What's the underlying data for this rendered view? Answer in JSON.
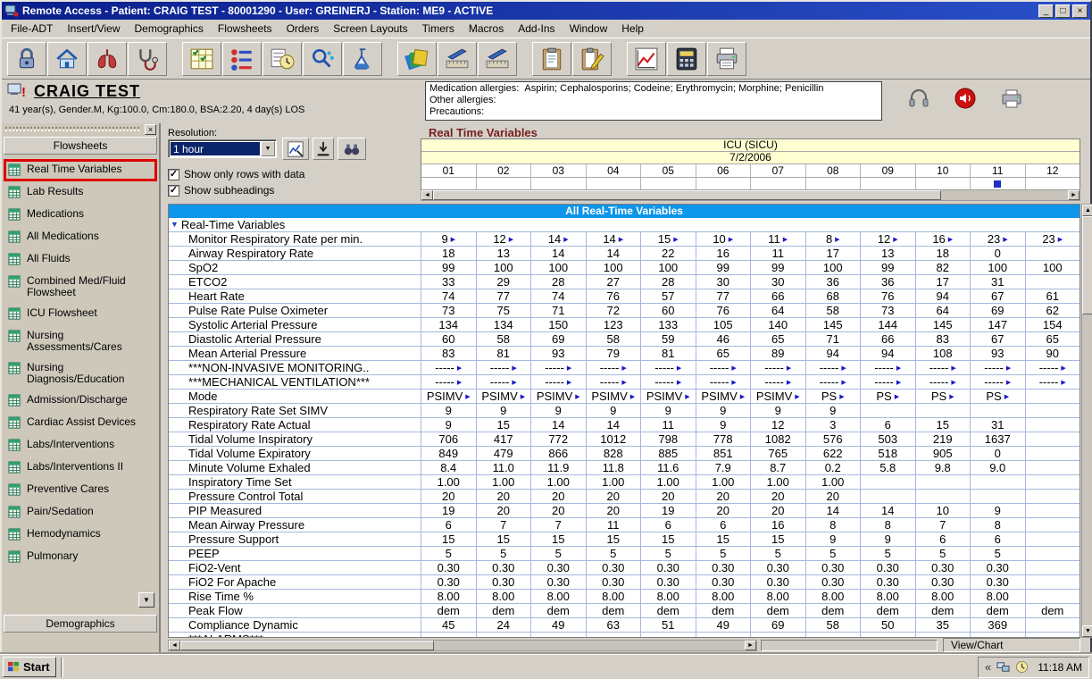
{
  "window": {
    "title": "Remote Access - Patient: CRAIG TEST - 80001290 - User: GREINERJ - Station: ME9 - ACTIVE"
  },
  "menu": {
    "items": [
      "File-ADT",
      "Insert/View",
      "Demographics",
      "Flowsheets",
      "Orders",
      "Screen Layouts",
      "Timers",
      "Macros",
      "Add-Ins",
      "Window",
      "Help"
    ]
  },
  "toolbar": {
    "groups": [
      [
        "lock-icon",
        "home-icon",
        "lungs-icon",
        "stethoscope-icon"
      ],
      [
        "flowsheet-grid-icon",
        "orders-icon",
        "clock-notes-icon",
        "probes-icon",
        "lab-icon"
      ],
      [
        "screen-layouts-icon",
        "ruler-pencil-icon",
        "ruler-pencil2-icon"
      ],
      [
        "clipboard-icon",
        "clipboard-pencil-icon"
      ],
      [
        "chart-icon",
        "calculator-icon",
        "printer-icon"
      ]
    ]
  },
  "patient": {
    "name": "CRAIG TEST",
    "details": "41 year(s), Gender.M, Kg:100.0, Cm:180.0, BSA:2.20, 4 day(s) LOS",
    "medication_allergies_label": "Medication allergies:",
    "medication_allergies": "Aspirin; Cephalosporins; Codeine; Erythromycin; Morphine; Penicillin",
    "other_allergies_label": "Other allergies:",
    "other_allergies": "",
    "precautions_label": "Precautions:",
    "precautions": "",
    "icons": [
      "headset-icon",
      "speaker-icon",
      "fax-icon"
    ]
  },
  "sidebar": {
    "header": "Flowsheets",
    "footer": "Demographics",
    "items": [
      {
        "label": "Real Time Variables",
        "selected": true
      },
      {
        "label": "Lab Results"
      },
      {
        "label": "Medications"
      },
      {
        "label": "All Medications"
      },
      {
        "label": "All Fluids"
      },
      {
        "label": "Combined Med/Fluid Flowsheet"
      },
      {
        "label": "ICU Flowsheet"
      },
      {
        "label": "Nursing Assessments/Cares"
      },
      {
        "label": "Nursing Diagnosis/Education"
      },
      {
        "label": "Admission/Discharge"
      },
      {
        "label": "Cardiac Assist Devices"
      },
      {
        "label": "Labs/Interventions"
      },
      {
        "label": "Labs/Interventions II"
      },
      {
        "label": "Preventive Cares"
      },
      {
        "label": "Pain/Sedation"
      },
      {
        "label": "Hemodynamics"
      },
      {
        "label": "Pulmonary"
      }
    ]
  },
  "controls": {
    "resolution_label": "Resolution:",
    "resolution_value": "1 hour",
    "show_rows_label": "Show only rows with data",
    "show_rows_checked": true,
    "show_subheadings_label": "Show subheadings",
    "show_subheadings_checked": true,
    "buttons": [
      "chart-view-icon",
      "export-icon",
      "binoculars-icon"
    ]
  },
  "flowsheet": {
    "title": "Real Time Variables",
    "unit": "ICU (SICU)",
    "date": "7/2/2006",
    "hours": [
      "01",
      "02",
      "03",
      "04",
      "05",
      "06",
      "07",
      "08",
      "09",
      "10",
      "11",
      "12"
    ],
    "marker_hour_index": 10,
    "table_title": "All Real-Time Variables",
    "section": "Real-Time Variables",
    "rows": [
      {
        "label": "Monitor Respiratory Rate per min.",
        "values": [
          "9",
          "12",
          "14",
          "14",
          "15",
          "10",
          "11",
          "8",
          "12",
          "16",
          "23",
          "23"
        ],
        "arrows": true
      },
      {
        "label": "Airway Respiratory Rate",
        "values": [
          "18",
          "13",
          "14",
          "14",
          "22",
          "16",
          "11",
          "17",
          "13",
          "18",
          "0",
          ""
        ]
      },
      {
        "label": "SpO2",
        "values": [
          "99",
          "100",
          "100",
          "100",
          "100",
          "99",
          "99",
          "100",
          "99",
          "82",
          "100",
          "100"
        ]
      },
      {
        "label": "ETCO2",
        "values": [
          "33",
          "29",
          "28",
          "27",
          "28",
          "30",
          "30",
          "36",
          "36",
          "17",
          "31",
          ""
        ]
      },
      {
        "label": "Heart Rate",
        "values": [
          "74",
          "77",
          "74",
          "76",
          "57",
          "77",
          "66",
          "68",
          "76",
          "94",
          "67",
          "61"
        ]
      },
      {
        "label": "Pulse Rate Pulse Oximeter",
        "values": [
          "73",
          "75",
          "71",
          "72",
          "60",
          "76",
          "64",
          "58",
          "73",
          "64",
          "69",
          "62"
        ]
      },
      {
        "label": "Systolic Arterial Pressure",
        "values": [
          "134",
          "134",
          "150",
          "123",
          "133",
          "105",
          "140",
          "145",
          "144",
          "145",
          "147",
          "154"
        ]
      },
      {
        "label": "Diastolic Arterial Pressure",
        "values": [
          "60",
          "58",
          "69",
          "58",
          "59",
          "46",
          "65",
          "71",
          "66",
          "83",
          "67",
          "65"
        ]
      },
      {
        "label": "Mean Arterial Pressure",
        "values": [
          "83",
          "81",
          "93",
          "79",
          "81",
          "65",
          "89",
          "94",
          "94",
          "108",
          "93",
          "90"
        ]
      },
      {
        "label": "***NON-INVASIVE MONITORING..",
        "values": [
          "-----",
          "-----",
          "-----",
          "-----",
          "-----",
          "-----",
          "-----",
          "-----",
          "-----",
          "-----",
          "-----",
          "-----"
        ],
        "arrows": true
      },
      {
        "label": "***MECHANICAL VENTILATION***",
        "values": [
          "-----",
          "-----",
          "-----",
          "-----",
          "-----",
          "-----",
          "-----",
          "-----",
          "-----",
          "-----",
          "-----",
          "-----"
        ],
        "arrows": true
      },
      {
        "label": "Mode",
        "values": [
          "PSIMV",
          "PSIMV",
          "PSIMV",
          "PSIMV",
          "PSIMV",
          "PSIMV",
          "PSIMV",
          "PS",
          "PS",
          "PS",
          "PS",
          ""
        ],
        "arrows": true
      },
      {
        "label": "Respiratory Rate Set SIMV",
        "values": [
          "9",
          "9",
          "9",
          "9",
          "9",
          "9",
          "9",
          "9",
          "",
          "",
          "",
          ""
        ]
      },
      {
        "label": "Respiratory Rate Actual",
        "values": [
          "9",
          "15",
          "14",
          "14",
          "11",
          "9",
          "12",
          "3",
          "6",
          "15",
          "31",
          ""
        ]
      },
      {
        "label": "Tidal Volume Inspiratory",
        "values": [
          "706",
          "417",
          "772",
          "1012",
          "798",
          "778",
          "1082",
          "576",
          "503",
          "219",
          "1637",
          ""
        ]
      },
      {
        "label": "Tidal Volume Expiratory",
        "values": [
          "849",
          "479",
          "866",
          "828",
          "885",
          "851",
          "765",
          "622",
          "518",
          "905",
          "0",
          ""
        ]
      },
      {
        "label": "Minute Volume Exhaled",
        "values": [
          "8.4",
          "11.0",
          "11.9",
          "11.8",
          "11.6",
          "7.9",
          "8.7",
          "0.2",
          "5.8",
          "9.8",
          "9.0",
          ""
        ]
      },
      {
        "label": "Inspiratory Time Set",
        "values": [
          "1.00",
          "1.00",
          "1.00",
          "1.00",
          "1.00",
          "1.00",
          "1.00",
          "1.00",
          "",
          "",
          "",
          ""
        ]
      },
      {
        "label": "Pressure Control Total",
        "values": [
          "20",
          "20",
          "20",
          "20",
          "20",
          "20",
          "20",
          "20",
          "",
          "",
          "",
          ""
        ]
      },
      {
        "label": "PIP Measured",
        "values": [
          "19",
          "20",
          "20",
          "20",
          "19",
          "20",
          "20",
          "14",
          "14",
          "10",
          "9",
          ""
        ]
      },
      {
        "label": "Mean Airway Pressure",
        "values": [
          "6",
          "7",
          "7",
          "11",
          "6",
          "6",
          "16",
          "8",
          "8",
          "7",
          "8",
          ""
        ]
      },
      {
        "label": "Pressure Support",
        "values": [
          "15",
          "15",
          "15",
          "15",
          "15",
          "15",
          "15",
          "9",
          "9",
          "6",
          "6",
          ""
        ]
      },
      {
        "label": "PEEP",
        "values": [
          "5",
          "5",
          "5",
          "5",
          "5",
          "5",
          "5",
          "5",
          "5",
          "5",
          "5",
          ""
        ]
      },
      {
        "label": "FiO2-Vent",
        "values": [
          "0.30",
          "0.30",
          "0.30",
          "0.30",
          "0.30",
          "0.30",
          "0.30",
          "0.30",
          "0.30",
          "0.30",
          "0.30",
          ""
        ]
      },
      {
        "label": "FiO2 For Apache",
        "values": [
          "0.30",
          "0.30",
          "0.30",
          "0.30",
          "0.30",
          "0.30",
          "0.30",
          "0.30",
          "0.30",
          "0.30",
          "0.30",
          ""
        ]
      },
      {
        "label": "Rise Time %",
        "values": [
          "8.00",
          "8.00",
          "8.00",
          "8.00",
          "8.00",
          "8.00",
          "8.00",
          "8.00",
          "8.00",
          "8.00",
          "8.00",
          ""
        ]
      },
      {
        "label": "Peak Flow",
        "values": [
          "dem",
          "dem",
          "dem",
          "dem",
          "dem",
          "dem",
          "dem",
          "dem",
          "dem",
          "dem",
          "dem",
          "dem"
        ]
      },
      {
        "label": "Compliance Dynamic",
        "values": [
          "45",
          "24",
          "49",
          "63",
          "51",
          "49",
          "69",
          "58",
          "50",
          "35",
          "369",
          ""
        ]
      },
      {
        "label": "***ALARMS***",
        "values": [
          "-----",
          "-----",
          "-----",
          "-----",
          "-----",
          "-----",
          "-----",
          "-----",
          "-----",
          "-----",
          "-----",
          "-----"
        ],
        "arrows": true,
        "partial": true
      }
    ]
  },
  "statusbar": {
    "view_label": "View/Chart"
  },
  "taskbar": {
    "start": "Start",
    "time": "11:18 AM"
  }
}
